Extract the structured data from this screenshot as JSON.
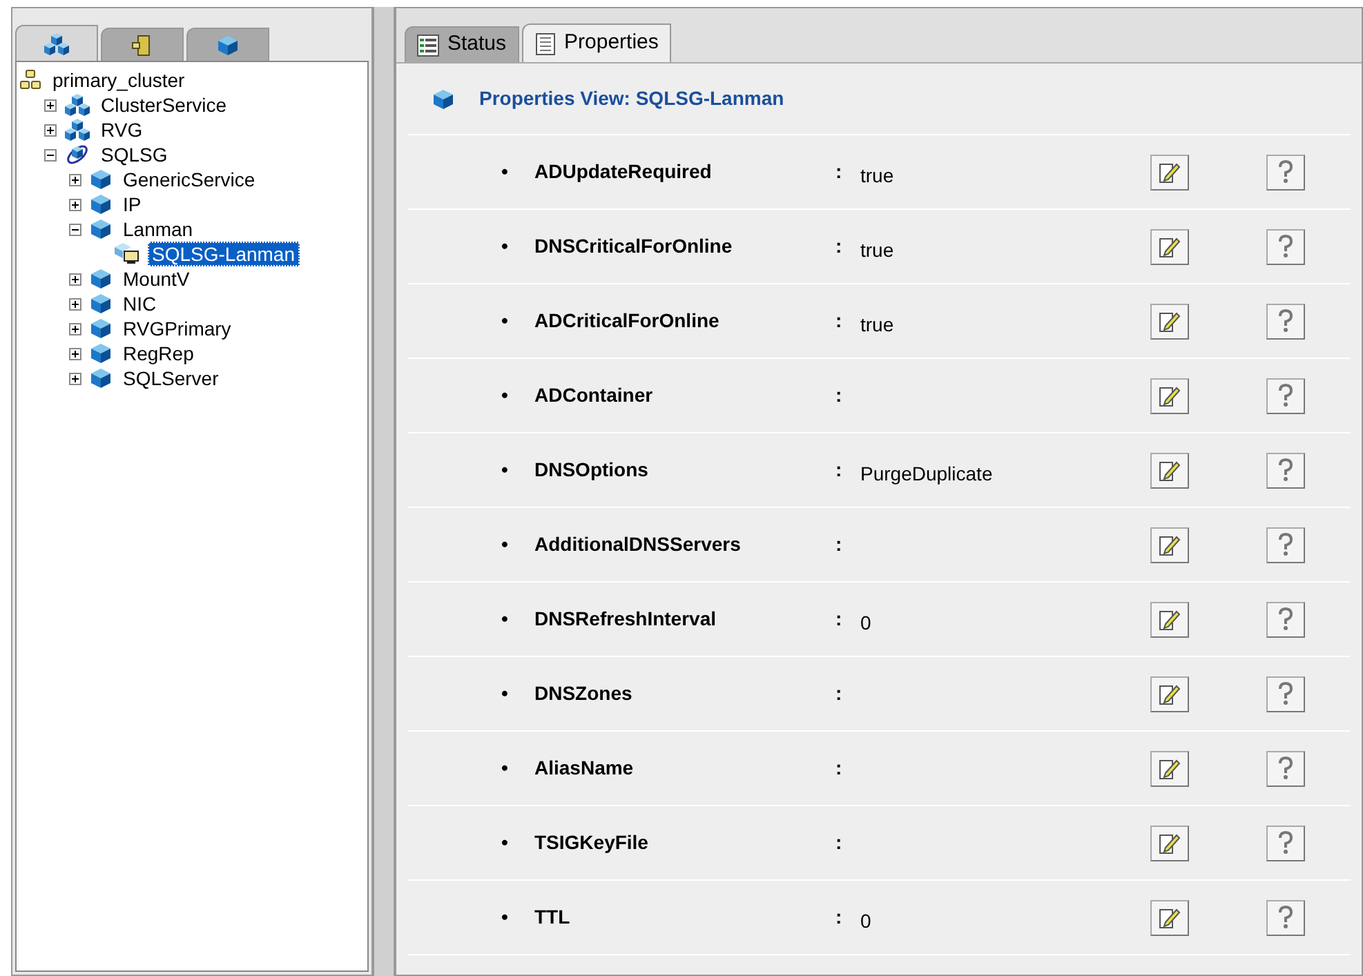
{
  "left_tabs": [
    {
      "kind": "groups",
      "selected": true
    },
    {
      "kind": "systems",
      "selected": false
    },
    {
      "kind": "resources",
      "selected": false
    }
  ],
  "tree": {
    "label": "primary_cluster",
    "kind": "cluster",
    "selected": false,
    "children": [
      {
        "label": "ClusterService",
        "kind": "group",
        "expanded": false,
        "selected": false
      },
      {
        "label": "RVG",
        "kind": "group",
        "expanded": false,
        "selected": false
      },
      {
        "label": "SQLSG",
        "kind": "service_group",
        "expanded": true,
        "selected": false,
        "children": [
          {
            "label": "GenericService",
            "kind": "resource",
            "expanded": false,
            "selected": false
          },
          {
            "label": "IP",
            "kind": "resource",
            "expanded": false,
            "selected": false
          },
          {
            "label": "Lanman",
            "kind": "resource",
            "expanded": true,
            "selected": false,
            "children": [
              {
                "label": "SQLSG-Lanman",
                "kind": "instance",
                "selected": true
              }
            ]
          },
          {
            "label": "MountV",
            "kind": "resource",
            "expanded": false,
            "selected": false
          },
          {
            "label": "NIC",
            "kind": "resource",
            "expanded": false,
            "selected": false
          },
          {
            "label": "RVGPrimary",
            "kind": "resource",
            "expanded": false,
            "selected": false
          },
          {
            "label": "RegRep",
            "kind": "resource",
            "expanded": false,
            "selected": false
          },
          {
            "label": "SQLServer",
            "kind": "resource",
            "expanded": false,
            "selected": false
          }
        ]
      }
    ]
  },
  "right_tabs": [
    {
      "label": "Status",
      "kind": "status",
      "selected": false
    },
    {
      "label": "Properties",
      "kind": "properties",
      "selected": true
    }
  ],
  "properties_title": "Properties View: SQLSG-Lanman",
  "properties": [
    {
      "name": "ADUpdateRequired",
      "value": "true"
    },
    {
      "name": "DNSCriticalForOnline",
      "value": "true"
    },
    {
      "name": "ADCriticalForOnline",
      "value": "true"
    },
    {
      "name": "ADContainer"
    },
    {
      "name": "DNSOptions",
      "value": "PurgeDuplicate"
    },
    {
      "name": "AdditionalDNSServers"
    },
    {
      "name": "DNSRefreshInterval",
      "value": "0"
    },
    {
      "name": "DNSZones"
    },
    {
      "name": "AliasName"
    },
    {
      "name": "TSIGKeyFile"
    },
    {
      "name": "TTL",
      "value": "0"
    }
  ],
  "separator": ":",
  "bullet": "•"
}
